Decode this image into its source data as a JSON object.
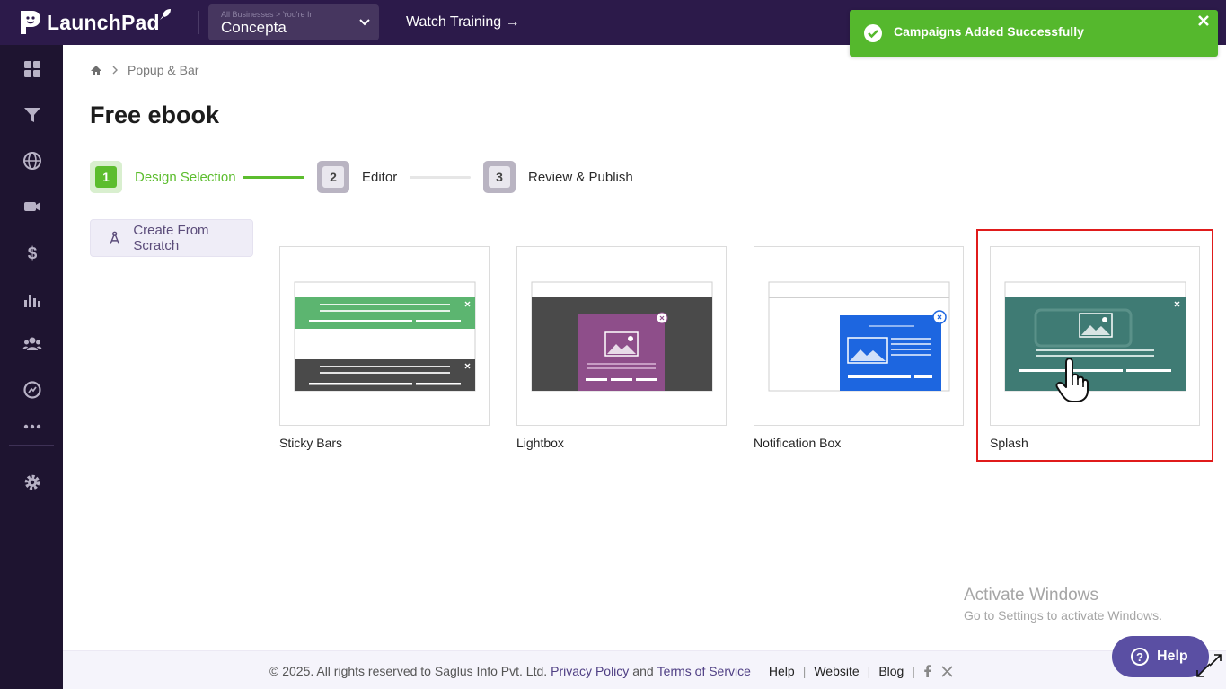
{
  "app": {
    "name": "LaunchPad"
  },
  "business": {
    "context_label": "All Businesses > You're In",
    "name": "Concepta"
  },
  "header": {
    "watch_training": "Watch Training →"
  },
  "toast": {
    "message": "Campaigns Added Successfully",
    "color": "#55b82d"
  },
  "breadcrumb": {
    "current": "Popup & Bar"
  },
  "page": {
    "title": "Free ebook"
  },
  "steps": [
    {
      "number": "1",
      "label": "Design Selection",
      "state": "active"
    },
    {
      "number": "2",
      "label": "Editor",
      "state": "inactive"
    },
    {
      "number": "3",
      "label": "Review & Publish",
      "state": "inactive"
    }
  ],
  "create_button": {
    "label": "Create From Scratch"
  },
  "templates": [
    {
      "label": "Sticky Bars",
      "selected": false
    },
    {
      "label": "Lightbox",
      "selected": false
    },
    {
      "label": "Notification Box",
      "selected": false
    },
    {
      "label": "Splash",
      "selected": true
    }
  ],
  "sidebar": {
    "icons": [
      "dashboard-icon",
      "funnel-icon",
      "globe-icon",
      "video-icon",
      "dollar-icon",
      "chart-icon",
      "users-icon",
      "analytics-icon",
      "more-icon",
      "settings-icon"
    ]
  },
  "footer": {
    "copyright": "©  2025. All rights reserved to Saglus Info Pvt. Ltd.",
    "privacy": "Privacy Policy",
    "and": "and",
    "terms": "Terms of Service",
    "help": "Help",
    "website": "Website",
    "blog": "Blog",
    "sep": "|"
  },
  "help_button": {
    "label": "Help"
  },
  "watermark": {
    "title": "Activate Windows",
    "subtitle": "Go to Settings to activate Windows."
  },
  "colors": {
    "brand": "#2c1a4a",
    "sidebar": "#1e1430",
    "accent_green": "#5cbd2e",
    "link": "#4f3f84",
    "selection": "#e01b1b"
  }
}
